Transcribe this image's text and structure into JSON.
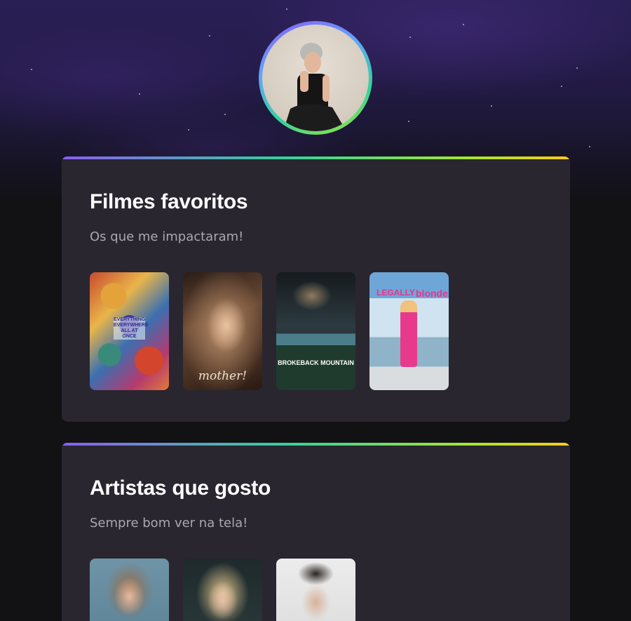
{
  "profile": {
    "avatar_alt": "Foto de perfil"
  },
  "sections": [
    {
      "title": "Filmes favoritos",
      "subtitle": "Os que me impactaram!",
      "items": [
        {
          "name": "everything-everywhere-poster",
          "text": "EVERYTHING EVERYWHERE ALL AT ONCE"
        },
        {
          "name": "mother-poster",
          "text": "mother!"
        },
        {
          "name": "brokeback-mountain-poster",
          "text": "BROKEBACK MOUNTAIN"
        },
        {
          "name": "legally-blonde-poster",
          "text_left": "LEGALLY",
          "text_right": "blonde"
        }
      ]
    },
    {
      "title": "Artistas que gosto",
      "subtitle": "Sempre bom ver na tela!",
      "items": [
        {
          "name": "artist-photo-1"
        },
        {
          "name": "artist-photo-2"
        },
        {
          "name": "artist-photo-3"
        }
      ]
    }
  ],
  "colors": {
    "card_background": "#29262f",
    "page_background": "#121214",
    "accent_gradient": [
      "#8b5cf6",
      "#34d399",
      "#a3e635",
      "#facc15"
    ]
  }
}
